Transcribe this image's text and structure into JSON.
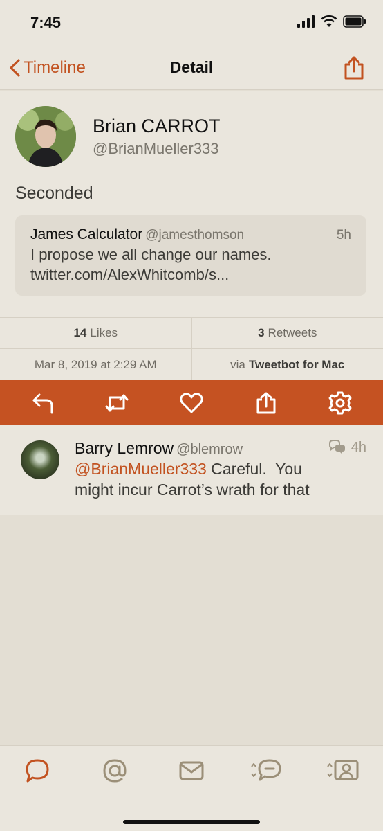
{
  "status_bar": {
    "time": "7:45"
  },
  "nav": {
    "back_label": "Timeline",
    "title": "Detail"
  },
  "tweet": {
    "author_name": "Brian CARROT",
    "author_handle": "@BrianMueller333",
    "text": "Seconded",
    "quote": {
      "name": "James Calculator",
      "handle": "@jamesthomson",
      "time": "5h",
      "line1": "I propose we all change our names.",
      "line2": "twitter.com/AlexWhitcomb/s..."
    },
    "likes_count": "14",
    "likes_label": "Likes",
    "retweets_count": "3",
    "retweets_label": "Retweets",
    "date": "Mar 8, 2019 at 2:29 AM",
    "via_prefix": "via",
    "via_app": "Tweetbot for Mac"
  },
  "actions": [
    "reply-icon",
    "retweet-icon",
    "like-icon",
    "share-icon",
    "settings-icon"
  ],
  "reply": {
    "name": "Barry Lemrow",
    "handle": "@blemrow",
    "time": "4h",
    "mention": "@BrianMueller333",
    "line1_rest": " Careful.  You",
    "line2": "might incur Carrot’s wrath for that"
  },
  "tabs": [
    "timeline-icon",
    "mentions-icon",
    "messages-icon",
    "lists-icon",
    "profile-icon"
  ],
  "colors": {
    "accent": "#c55222",
    "background": "#e3ded3",
    "muted": "#7a766d"
  }
}
